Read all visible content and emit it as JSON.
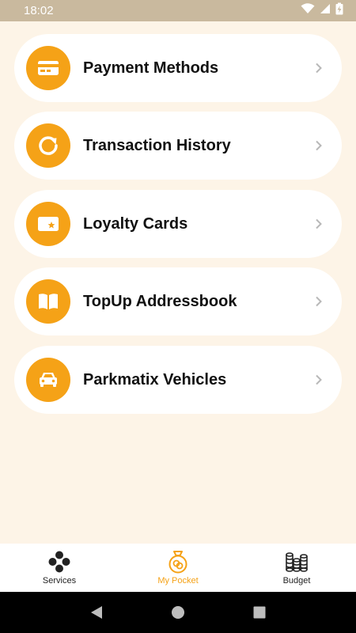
{
  "status": {
    "time": "18:02",
    "icons": [
      "wifi-icon",
      "signal-icon",
      "battery-charging-icon"
    ]
  },
  "menu": {
    "items": [
      {
        "label": "Payment Methods",
        "icon": "credit-card-icon"
      },
      {
        "label": "Transaction History",
        "icon": "refresh-icon"
      },
      {
        "label": "Loyalty Cards",
        "icon": "loyalty-card-icon"
      },
      {
        "label": "TopUp Addressbook",
        "icon": "book-icon"
      },
      {
        "label": "Parkmatix Vehicles",
        "icon": "car-icon"
      }
    ]
  },
  "bottom_nav": {
    "items": [
      {
        "label": "Services",
        "icon": "services-icon"
      },
      {
        "label": "My Pocket",
        "icon": "pocket-icon",
        "active": true
      },
      {
        "label": "Budget",
        "icon": "coins-icon"
      }
    ]
  },
  "colors": {
    "accent": "#f5a217",
    "background": "#fdf4e7",
    "status_bar": "#c9b99e"
  }
}
